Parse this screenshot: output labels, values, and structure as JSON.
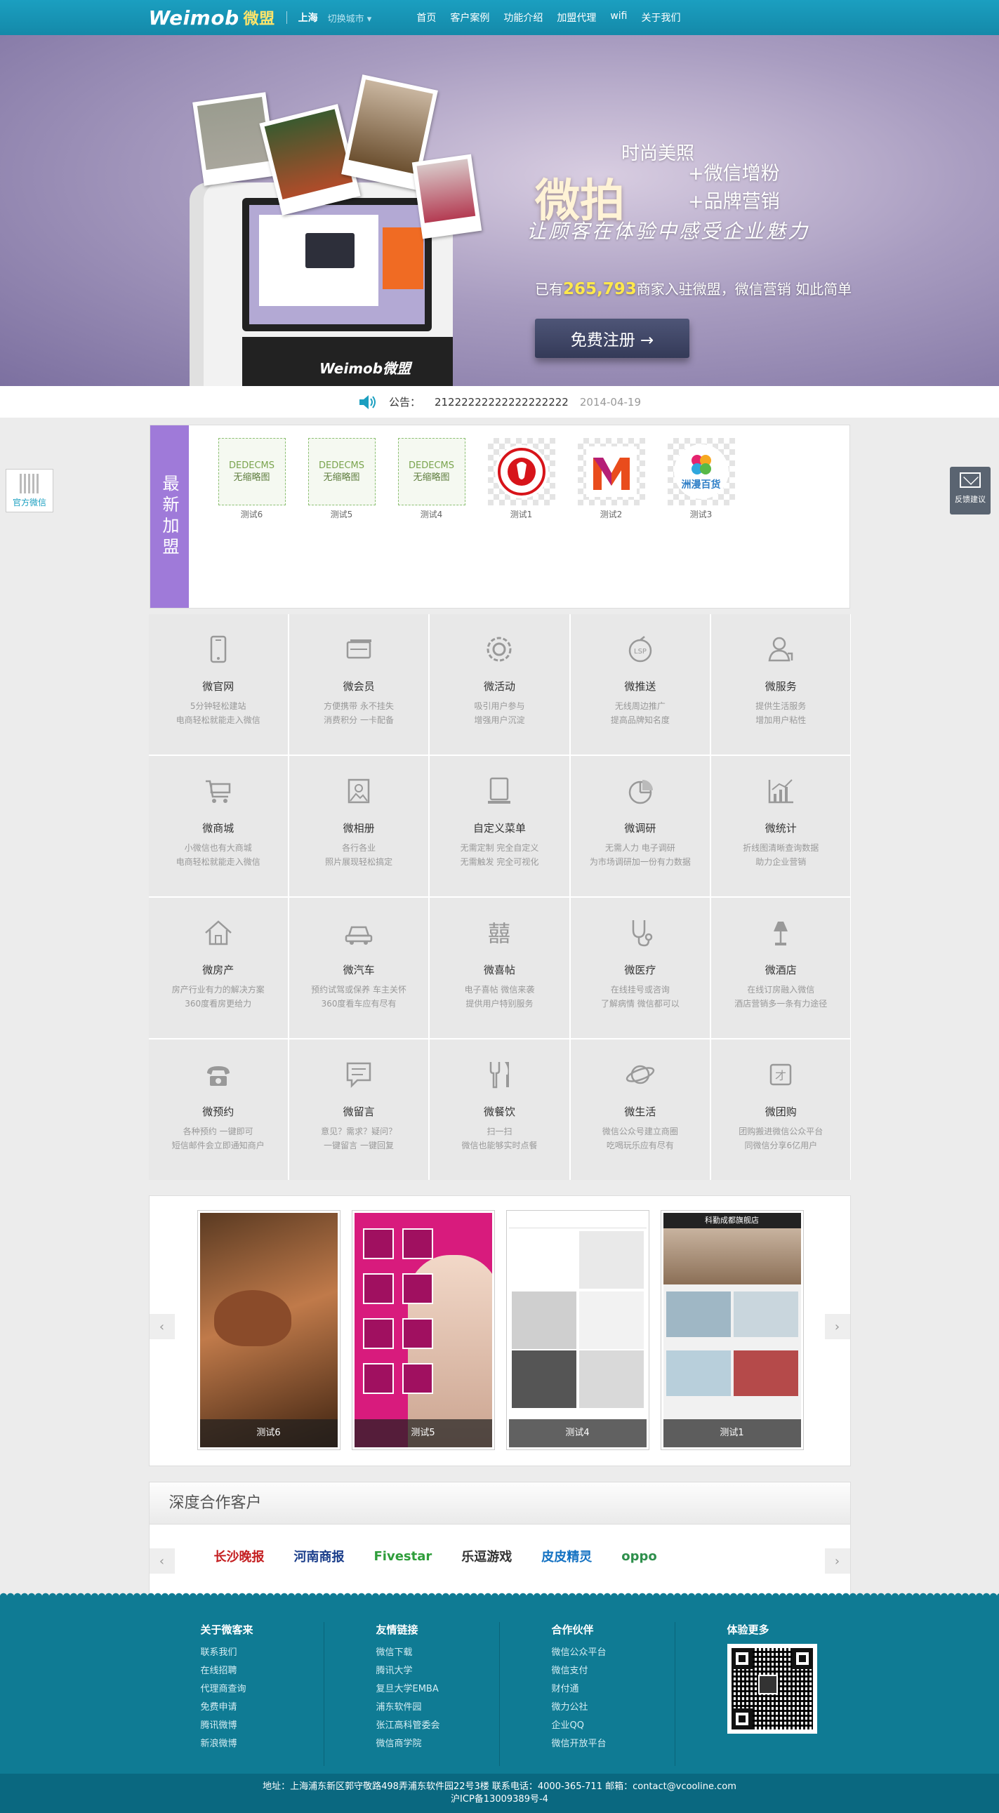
{
  "topbar": {
    "logo_text": "Weimob",
    "logo_sub": "微盟",
    "city": "上海",
    "city_switch": "切换城市",
    "nav": [
      "首页",
      "客户案例",
      "功能介绍",
      "加盟代理",
      "wifi",
      "关于我们"
    ]
  },
  "banner": {
    "tagline": "时尚美照",
    "title": "微拍",
    "line1": "+微信增粉",
    "line2": "+品牌营销",
    "slogan": "让顾客在体验中感受企业魅力",
    "count_prefix": "已有",
    "count": "265,793",
    "count_suffix": "商家入驻微盟，微信营销 如此简单",
    "cta": "免费注册 →",
    "kiosk_logo": "Weimob微盟",
    "dots_total": 10,
    "dots_active": 3
  },
  "announcement": {
    "label": "公告：",
    "text": "21222222222222222222",
    "date": "2014-04-19"
  },
  "side_left": {
    "label": "官方微信"
  },
  "side_right": {
    "label": "反馈建议"
  },
  "latest": {
    "tab": "最新加盟",
    "items": [
      {
        "name": "测试6",
        "logo_line1": "DEDECMS",
        "logo_line2": "无缩略图",
        "type": "dede"
      },
      {
        "name": "测试5",
        "logo_line1": "DEDECMS",
        "logo_line2": "无缩略图",
        "type": "dede"
      },
      {
        "name": "测试4",
        "logo_line1": "DEDECMS",
        "logo_line2": "无缩略图",
        "type": "dede"
      },
      {
        "name": "测试1",
        "type": "logo-red"
      },
      {
        "name": "测试2",
        "type": "logo-m"
      },
      {
        "name": "测试3",
        "logo_line1": "洲漫百货",
        "type": "logo-flower"
      }
    ]
  },
  "features": [
    {
      "title": "微官网",
      "desc1": "5分钟轻松建站",
      "desc2": "电商轻松就能走入微信",
      "icon": "phone-icon"
    },
    {
      "title": "微会员",
      "desc1": "方便携带 永不挂失",
      "desc2": "消费积分 一卡配备",
      "icon": "card-icon"
    },
    {
      "title": "微活动",
      "desc1": "吸引用户参与",
      "desc2": "增强用户沉淀",
      "icon": "gear-icon"
    },
    {
      "title": "微推送",
      "desc1": "无线周边推广",
      "desc2": "提高品牌知名度",
      "icon": "lsp-icon"
    },
    {
      "title": "微服务",
      "desc1": "提供生活服务",
      "desc2": "增加用户粘性",
      "icon": "user-icon"
    },
    {
      "title": "微商城",
      "desc1": "小微信也有大商城",
      "desc2": "电商轻松就能走入微信",
      "icon": "cart-icon"
    },
    {
      "title": "微相册",
      "desc1": "各行各业",
      "desc2": "照片展现轻松搞定",
      "icon": "photo-icon"
    },
    {
      "title": "自定义菜单",
      "desc1": "无需定制 完全自定义",
      "desc2": "无需触发 完全可视化",
      "icon": "menu-icon"
    },
    {
      "title": "微调研",
      "desc1": "无需人力 电子调研",
      "desc2": "为市场调研加一份有力数据",
      "icon": "pie-icon"
    },
    {
      "title": "微统计",
      "desc1": "折线图清晰查询数据",
      "desc2": "助力企业营销",
      "icon": "chart-icon"
    },
    {
      "title": "微房产",
      "desc1": "房产行业有力的解决方案",
      "desc2": "360度看房更给力",
      "icon": "house-icon"
    },
    {
      "title": "微汽车",
      "desc1": "预约试驾或保养 车主关怀",
      "desc2": "360度看车应有尽有",
      "icon": "car-icon"
    },
    {
      "title": "微喜帖",
      "desc1": "电子喜帖 微信来袭",
      "desc2": "提供用户特别服务",
      "icon": "double-happiness-icon"
    },
    {
      "title": "微医疗",
      "desc1": "在线挂号或咨询",
      "desc2": "了解病情 微信都可以",
      "icon": "stethoscope-icon"
    },
    {
      "title": "微酒店",
      "desc1": "在线订房融入微信",
      "desc2": "酒店营销多一条有力途径",
      "icon": "lamp-icon"
    },
    {
      "title": "微预约",
      "desc1": "各种预约 一键即可",
      "desc2": "短信邮件会立即通知商户",
      "icon": "telephone-icon"
    },
    {
      "title": "微留言",
      "desc1": "意见？需求？疑问？",
      "desc2": "一键留言 一键回复",
      "icon": "message-icon"
    },
    {
      "title": "微餐饮",
      "desc1": "扫一扫",
      "desc2": "微信也能够实时点餐",
      "icon": "fork-knife-icon"
    },
    {
      "title": "微生活",
      "desc1": "微信公众号建立商圈",
      "desc2": "吃喝玩乐应有尽有",
      "icon": "planet-icon"
    },
    {
      "title": "微团购",
      "desc1": "团购搬进微信公众平台",
      "desc2": "同微信分享6亿用户",
      "icon": "tuan-icon"
    }
  ],
  "cases": {
    "items": [
      {
        "caption": "测试6",
        "style": "s6"
      },
      {
        "caption": "测试5",
        "style": "s5"
      },
      {
        "caption": "测试4",
        "style": "s4"
      },
      {
        "caption": "测试1",
        "style": "s1",
        "header": "科勤成都旗舰店"
      }
    ]
  },
  "partners": {
    "title": "深度合作客户",
    "logos": [
      {
        "name": "长沙晚报",
        "color": "#c41e20"
      },
      {
        "name": "河南商报",
        "color": "#1a3d8a"
      },
      {
        "name": "Fivestar",
        "color": "#2f9e3b"
      },
      {
        "name": "乐逗游戏",
        "color": "#333333"
      },
      {
        "name": "皮皮精灵",
        "color": "#1371c2"
      },
      {
        "name": "oppo",
        "color": "#2e8f4c"
      }
    ]
  },
  "footer": {
    "columns": [
      {
        "title": "关于微客来",
        "links": [
          "联系我们",
          "在线招聘",
          "代理商查询",
          "免费申请",
          "腾讯微博",
          "新浪微博"
        ]
      },
      {
        "title": "友情链接",
        "links": [
          "微信下载",
          "腾讯大学",
          "复旦大学EMBA",
          "浦东软件园",
          "张江高科管委会",
          "微信商学院"
        ]
      },
      {
        "title": "合作伙伴",
        "links": [
          "微信公众平台",
          "微信支付",
          "财付通",
          "微力公社",
          "企业QQ",
          "微信开放平台"
        ]
      },
      {
        "title": "体验更多",
        "links": []
      }
    ],
    "address": "地址：上海浦东新区郭守敬路498弄浦东软件园22号3楼 联系电话：4000-365-711 邮箱：contact@vcooline.com",
    "icp": "沪ICP备13009389号-4"
  },
  "colors": {
    "brand": "#1b9fc0",
    "latest_tab": "#9f7ad9",
    "footer": "#0f7b94"
  }
}
